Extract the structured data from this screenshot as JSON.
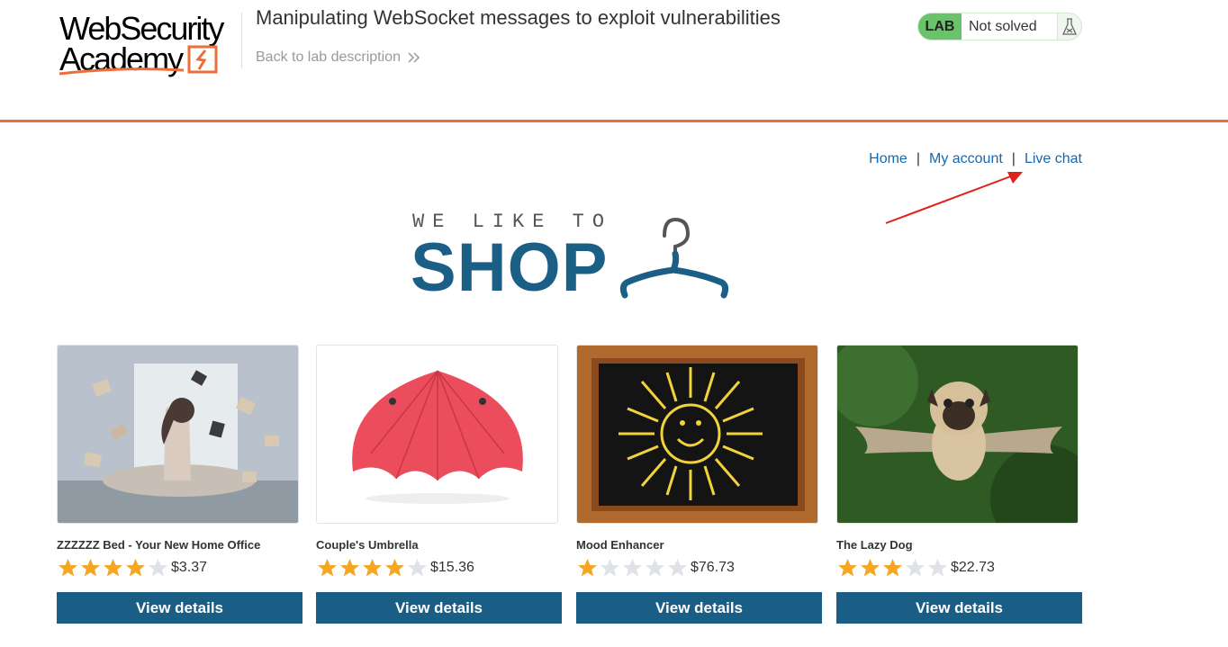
{
  "header": {
    "logo_line1": "WebSecurity",
    "logo_line2": "Academy",
    "lab_title": "Manipulating WebSocket messages to exploit vulnerabilities",
    "back_link": "Back to lab description",
    "badge_label": "LAB",
    "badge_status": "Not solved"
  },
  "nav": {
    "home": "Home",
    "separator": "|",
    "my_account": "My account",
    "live_chat": "Live chat"
  },
  "shop_logo": {
    "tagline": "WE LIKE TO",
    "word": "SHOP"
  },
  "products": [
    {
      "name": "ZZZZZZ Bed - Your New Home Office",
      "rating": 4,
      "price": "$3.37",
      "button": "View details"
    },
    {
      "name": "Couple's Umbrella",
      "rating": 4,
      "price": "$15.36",
      "button": "View details"
    },
    {
      "name": "Mood Enhancer",
      "rating": 1,
      "price": "$76.73",
      "button": "View details"
    },
    {
      "name": "The Lazy Dog",
      "rating": 3,
      "price": "$22.73",
      "button": "View details"
    }
  ],
  "colors": {
    "accent_orange": "#ed6e39",
    "link_blue": "#1668b0",
    "button_blue": "#1a5e85",
    "lab_green": "#6ac26a",
    "star_gold": "#f5a623",
    "star_empty": "#dfe3e8"
  }
}
